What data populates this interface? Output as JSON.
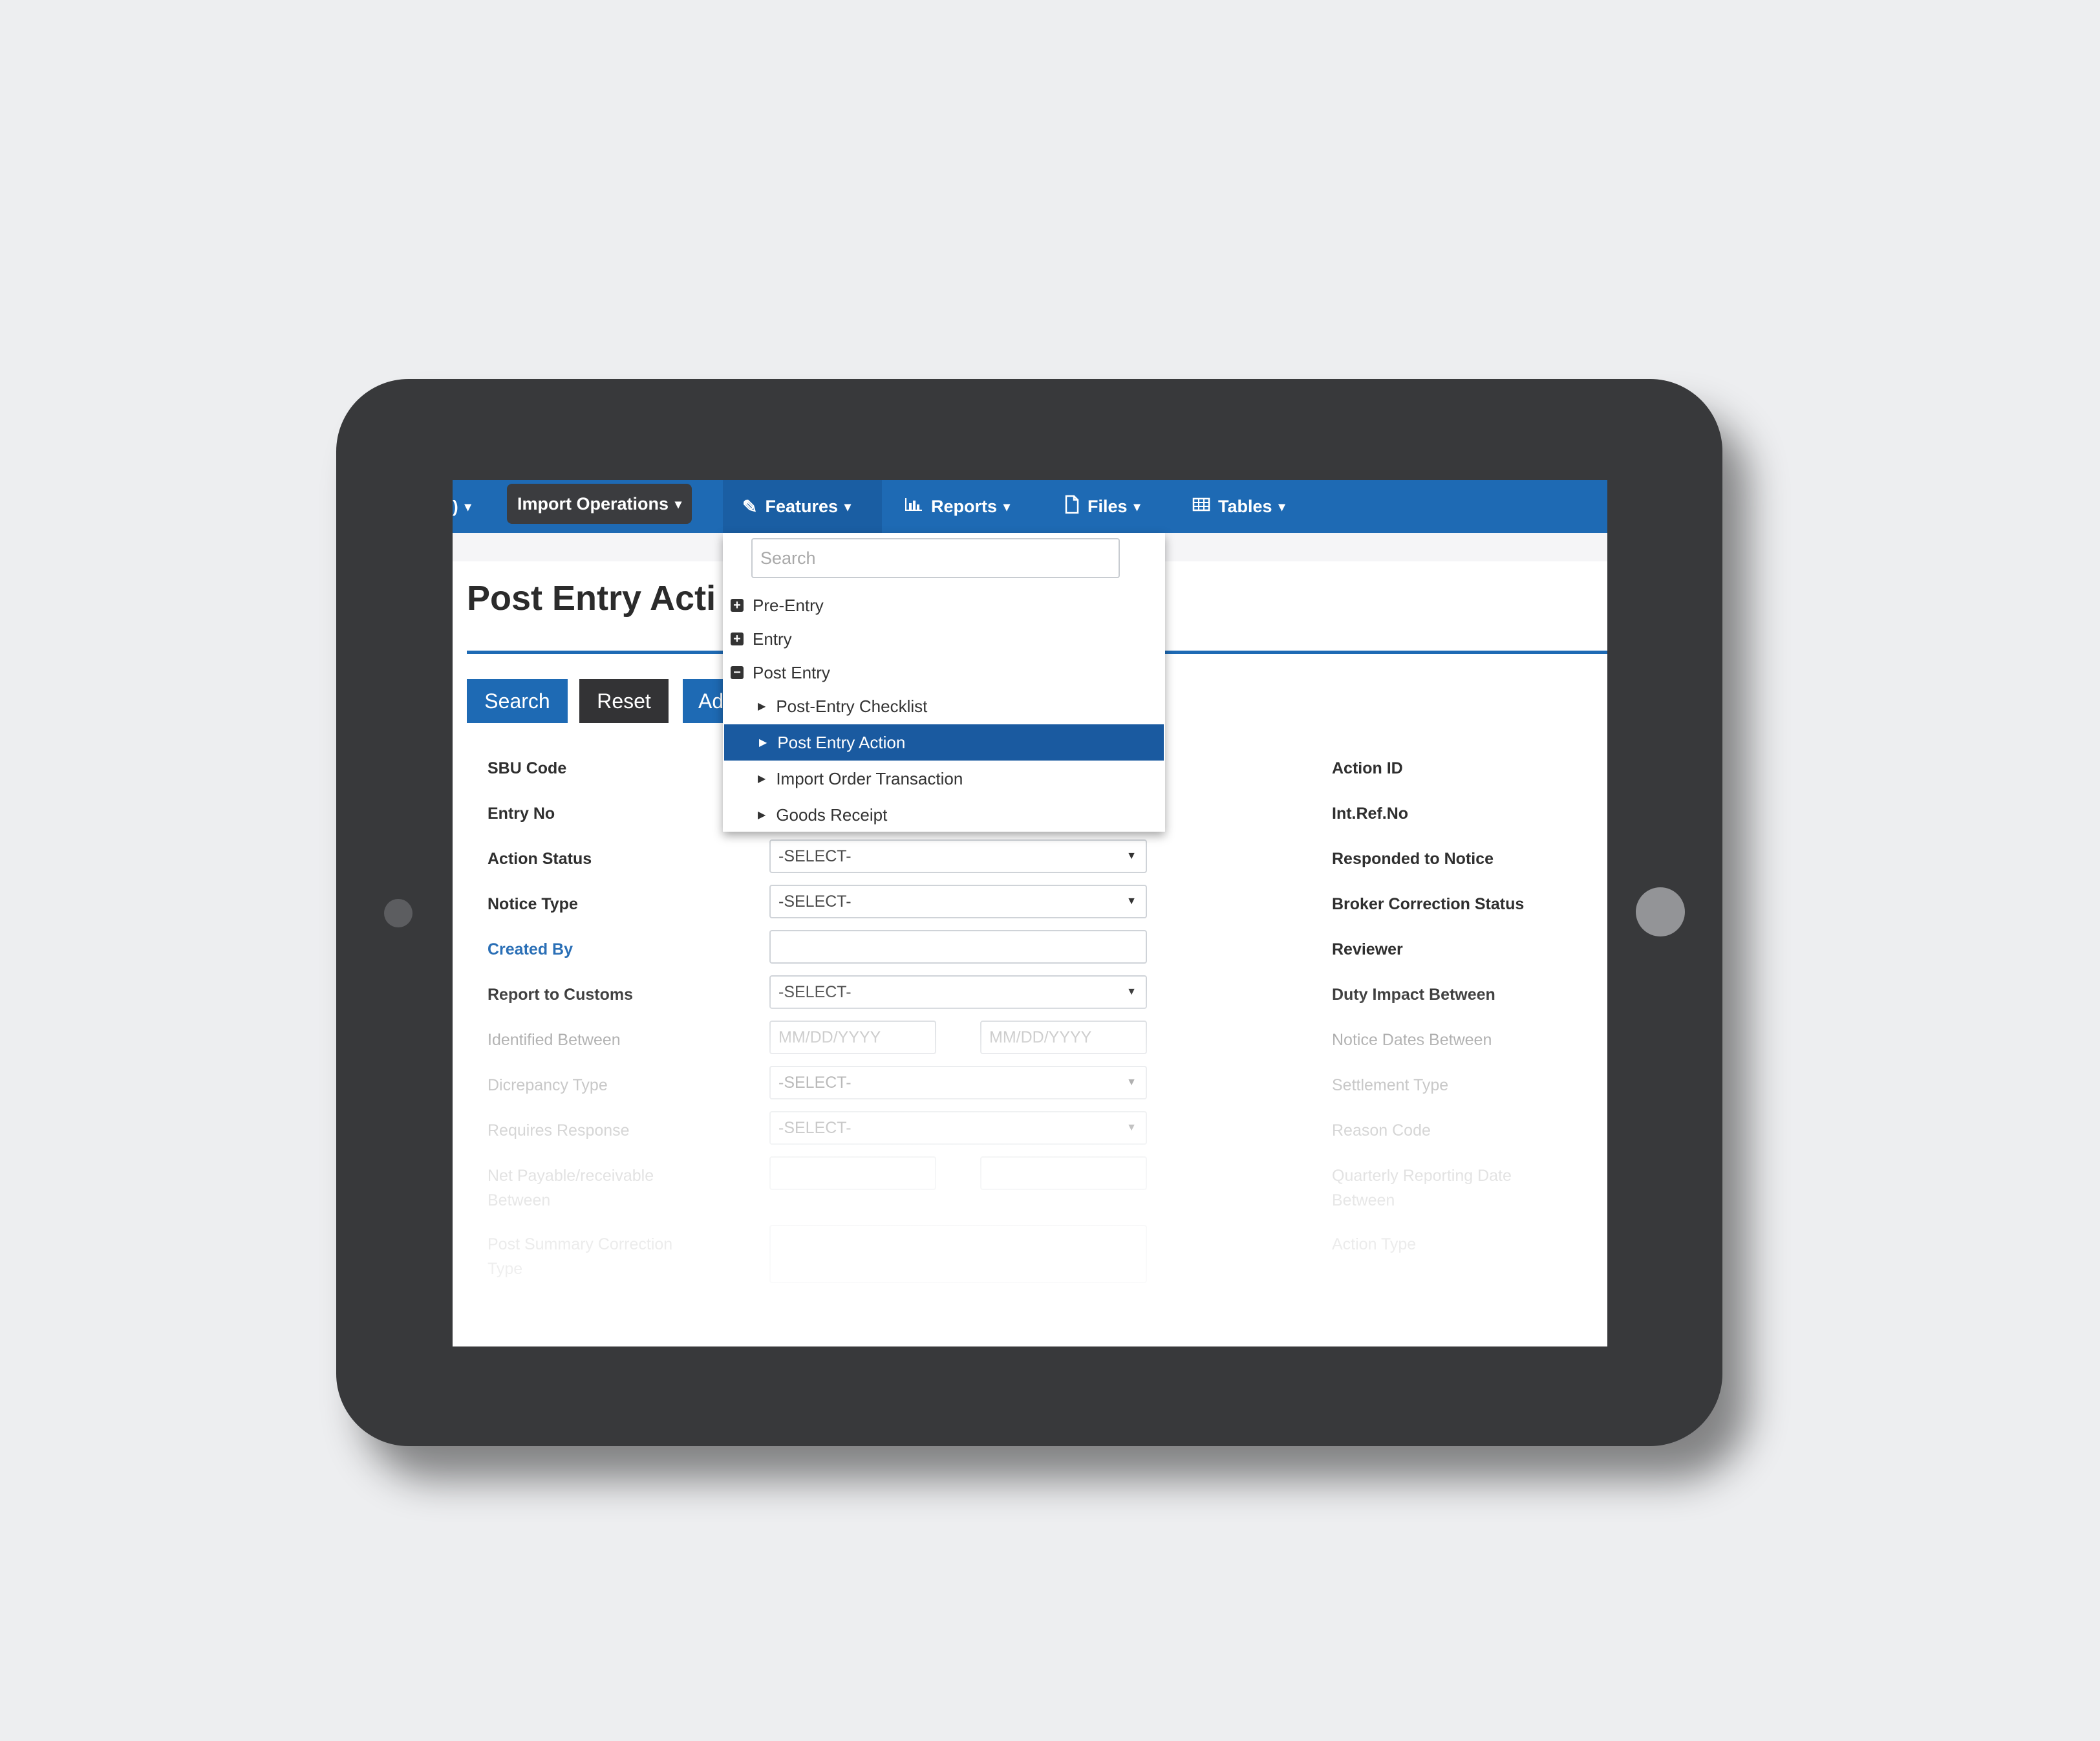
{
  "navbar": {
    "partial_caret": "▾",
    "items": [
      {
        "label": "Import Operations",
        "icon": "",
        "caret": "▾"
      },
      {
        "label": "Features",
        "icon": "pencil-icon",
        "caret": "▾"
      },
      {
        "label": "Reports",
        "icon": "bar-chart-icon",
        "caret": "▾"
      },
      {
        "label": "Files",
        "icon": "file-icon",
        "caret": "▾"
      },
      {
        "label": "Tables",
        "icon": "table-icon",
        "caret": "▾"
      }
    ]
  },
  "page": {
    "title": "Post Entry Acti"
  },
  "buttons": {
    "search": "Search",
    "reset": "Reset",
    "add": "Ad"
  },
  "form": {
    "left_labels": [
      "SBU Code",
      "Entry No",
      "Action Status",
      "Notice Type",
      "Created By",
      "Report to Customs",
      "Identified Between",
      "Dicrepancy Type",
      "Requires Response",
      "Net Payable/receivable",
      "Between",
      "Post Summary Correction",
      "Type"
    ],
    "right_labels": [
      "Action ID",
      "Int.Ref.No",
      "Responded to Notice",
      "Broker Correction Status",
      "Reviewer",
      "Duty Impact Between",
      "Notice Dates Between",
      "Settlement Type",
      "Reason Code",
      "Quarterly Reporting Date",
      "Between",
      "Action Type"
    ],
    "action_status_value": "-SELECT-",
    "notice_type_value": "-SELECT-",
    "created_by_value": "",
    "report_to_customs_value": "-SELECT-",
    "identified_from_placeholder": "MM/DD/YYYY",
    "identified_to_placeholder": "MM/DD/YYYY",
    "dicrepancy_type_value": "-SELECT-",
    "requires_response_value": "-SELECT-"
  },
  "features_menu": {
    "search_placeholder": "Search",
    "groups": [
      {
        "label": "Pre-Entry",
        "symbol": "+"
      },
      {
        "label": "Entry",
        "symbol": "+"
      },
      {
        "label": "Post Entry",
        "symbol": "−"
      }
    ],
    "items": [
      {
        "label": "Post-Entry Checklist",
        "active": false
      },
      {
        "label": "Post Entry Action",
        "active": true
      },
      {
        "label": "Import Order Transaction",
        "active": false
      },
      {
        "label": "Goods Receipt",
        "active": false
      }
    ]
  },
  "colors": {
    "nav_blue": "#1e6ab4",
    "active_item": "#1a5aa0",
    "tablet_frame": "#38393b",
    "background": "#edeef0"
  }
}
